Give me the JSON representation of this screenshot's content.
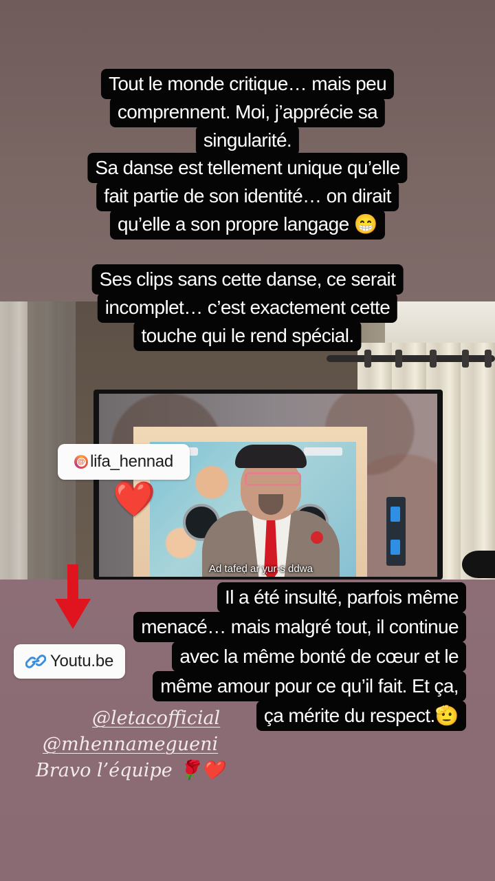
{
  "caption_top": {
    "lines": [
      "Tout le monde critique… mais peu",
      "comprennent. Moi, j’apprécie sa",
      "singularité.",
      "Sa danse est tellement unique qu’elle",
      "fait partie de son identité… on dirait",
      "qu’elle a son propre langage 😁"
    ]
  },
  "caption_middle": {
    "lines": [
      "Ses clips sans cette danse, ce serait",
      "incomplet… c’est exactement cette",
      "touche qui le rend spécial."
    ]
  },
  "video": {
    "subtitle": "Ad tafeḍ ar ỵur-s ddwa"
  },
  "mention_sticker": {
    "username": "lifa_hennad",
    "at_symbol": "@"
  },
  "heart_emoji": "❤️",
  "link_sticker": {
    "label": "Youtu.be",
    "icon": "link-icon"
  },
  "caption_bottom": {
    "lines": [
      "Il a été insulté, parfois même",
      "menacé… mais malgré tout, il continue",
      "avec la même bonté de cœur et le",
      "même amour pour ce qu’il fait. Et ça,",
      "ça mérite du respect.🫡"
    ]
  },
  "credits": {
    "line1": "@letacofficial",
    "line2": "@mhennamegueni",
    "line3": "Bravo l’équipe",
    "emojis": "🌹❤️"
  },
  "colors": {
    "caption_bg": "#050505",
    "caption_text": "#ffffff",
    "arrow": "#e0141e",
    "heart": "#e5232f"
  }
}
